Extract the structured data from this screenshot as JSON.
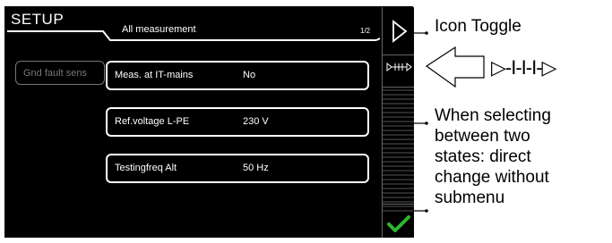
{
  "header": {
    "title": "SETUP",
    "subtitle": "All measurement",
    "page": "1/2"
  },
  "disabled_item": {
    "label": "Gnd fault sens"
  },
  "settings": [
    {
      "label": "Meas. at IT-mains",
      "value": "No"
    },
    {
      "label": "Ref.voltage L-PE",
      "value": "230 V"
    },
    {
      "label": "Testingfreq Alt",
      "value": "50 Hz"
    }
  ],
  "side_buttons": {
    "next_icon": "triangle-right-icon",
    "toggle_icon": "dash-toggle-icon",
    "confirm_icon": "checkmark-icon"
  },
  "annotations": {
    "icon_toggle": "Icon Toggle",
    "toggle_symbol": "▷-I-I-I-▷",
    "description_lines": [
      "When selecting",
      "between two",
      "states: direct",
      "change without",
      "submenu"
    ]
  },
  "colors": {
    "background": "#000000",
    "text": "#ffffff",
    "confirm": "#2fb52f",
    "disabled": "#777777"
  }
}
